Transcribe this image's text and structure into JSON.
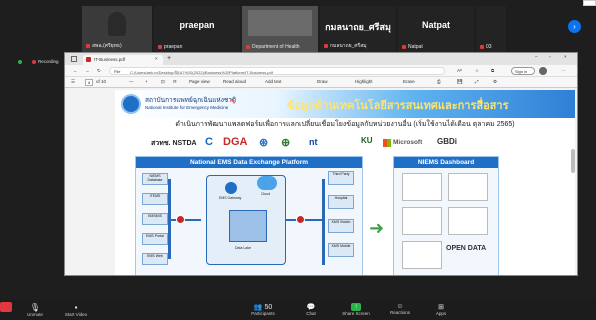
{
  "participants": [
    {
      "name": "สพฉ.(ศรียุทธ)",
      "big": ""
    },
    {
      "name": "praepan",
      "big": "praepan"
    },
    {
      "name": "Department of Health",
      "big": ""
    },
    {
      "name": "กมลนาถย_ศรีสมุ",
      "big": "กมลนาถย_ศรีสมุ"
    },
    {
      "name": "Natpat",
      "big": "Natpat"
    },
    {
      "name": "03",
      "big": ""
    }
  ],
  "recording": "Recording",
  "browser": {
    "tab_title": "IT-Business.pdf",
    "file_label": "File",
    "url": "C:/Users/aek.m/Desktop/ป้อนา%20(2022)/Business%20Platform/IT-Business.pdf",
    "signin": "Sign in",
    "page_current": "4",
    "page_total": "of 10",
    "page_view": "Page view",
    "read_aloud": "Read aloud",
    "add_text": "Add text",
    "draw": "Draw",
    "highlight": "Highlight",
    "erase": "Erase"
  },
  "slide": {
    "org_th": "สถาบันการแพทย์ฉุกเฉินแห่งชาติ",
    "org_en": "National Institute for Emergency Medicine",
    "header_title": "ข้อมูลด้านเทคโนโลยีสารสนเทศและการสื่อสาร",
    "subtitle": "ดำเนินการพัฒนาแพลตฟอร์มเพื่อการแลกเปลี่ยนเชื่อมโยงข้อมูลกับหน่วยงานอื่น (เริ่มใช้งานได้เดือน ตุลาคม 2565)",
    "logos": [
      "สวทช. NSTDA",
      "C",
      "DGA",
      "⊛",
      "⊕",
      "nt",
      "KU",
      "Microsoft",
      "GBDi"
    ],
    "platform_title": "National EMS Data Exchange Platform",
    "dashboard_title": "NIEMS Dashboard",
    "nodes": [
      "NIEMS Database",
      "ITEMS",
      "EMSMIS",
      "EMS Portal",
      "EMS Web"
    ],
    "gateway": "EMS Gateway",
    "cloud": "Cloud",
    "datalake": "Data Lake",
    "right_nodes": [
      "Third Party",
      "Hospital",
      "KMS Switch",
      "KMS Mobile"
    ],
    "opendata": "OPEN DATA"
  },
  "toolbar": {
    "unmute": "Unmute",
    "start_video": "Start Video",
    "participants": "Participants",
    "participants_count": "50",
    "chat": "Chat",
    "share_screen": "Share Screen",
    "reactions": "Reactions",
    "apps": "Apps"
  },
  "colors": {
    "accent": "#1f6fc7",
    "share": "#2bb34a",
    "danger": "#e0383e",
    "zoom_blue": "#0e72ed"
  }
}
